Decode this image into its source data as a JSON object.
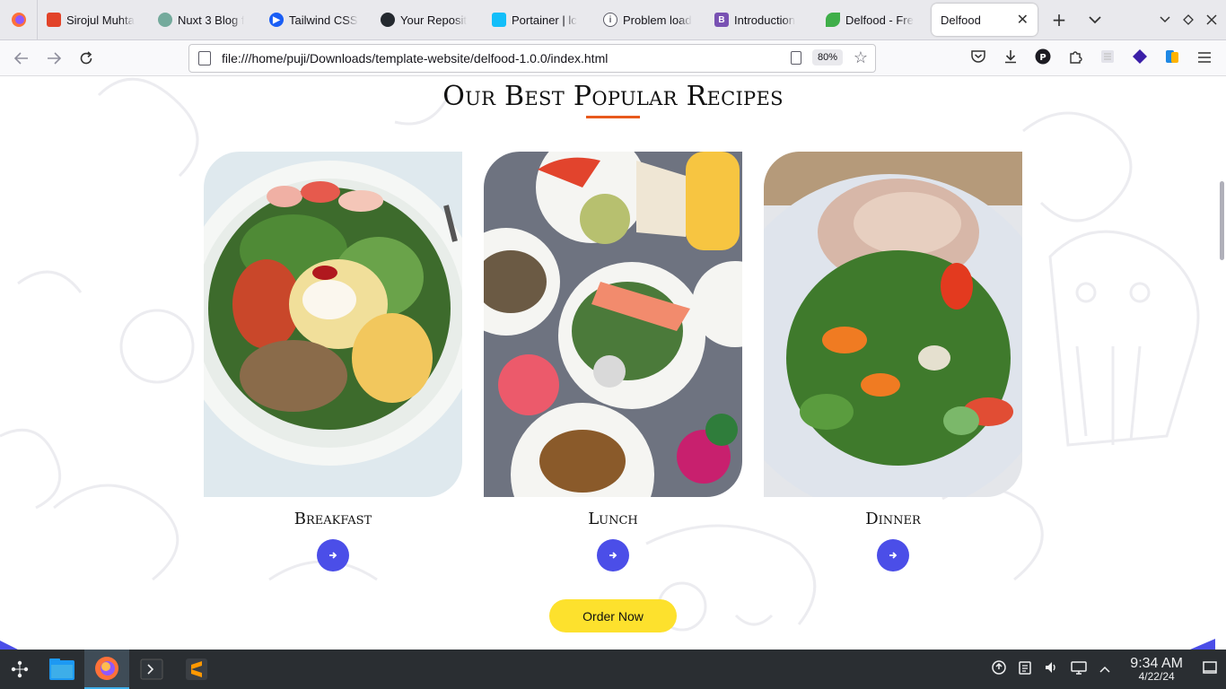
{
  "browser": {
    "tabs": [
      {
        "title": "Sirojul Muhta",
        "color": "#e24329",
        "icon": "gitlab-icon"
      },
      {
        "title": "Nuxt 3 Blog f",
        "color": "#74aa9c",
        "icon": "chatgpt-icon"
      },
      {
        "title": "Tailwind CSS",
        "color": "#1a5ef5",
        "icon": "play-icon"
      },
      {
        "title": "Your Reposit",
        "color": "#24292f",
        "icon": "github-icon"
      },
      {
        "title": "Portainer | lc",
        "color": "#13bef9",
        "icon": "portainer-icon"
      },
      {
        "title": "Problem load",
        "color": "#5b5b66",
        "icon": "info-icon"
      },
      {
        "title": "Introduction",
        "color": "#7952b3",
        "icon": "bootstrap-icon"
      },
      {
        "title": "Delfood - Fre",
        "color": "#3fae49",
        "icon": "leaf-icon"
      }
    ],
    "active_tab": {
      "title": "Delfood",
      "close": "✕"
    },
    "new_tab": "+",
    "url": "file:///home/puji/Downloads/template-website/delfood-1.0.0/index.html",
    "zoom": "80%"
  },
  "page": {
    "heading": "Our Best Popular Recipes",
    "cards": [
      {
        "title": "Breakfast"
      },
      {
        "title": "Lunch"
      },
      {
        "title": "Dinner"
      }
    ],
    "order_button": "Order Now",
    "accent": "#e8591c",
    "button_color": "#4b4ee8",
    "order_color": "#fde12d"
  },
  "taskbar": {
    "time": "9:34 AM",
    "date": "4/22/24"
  }
}
